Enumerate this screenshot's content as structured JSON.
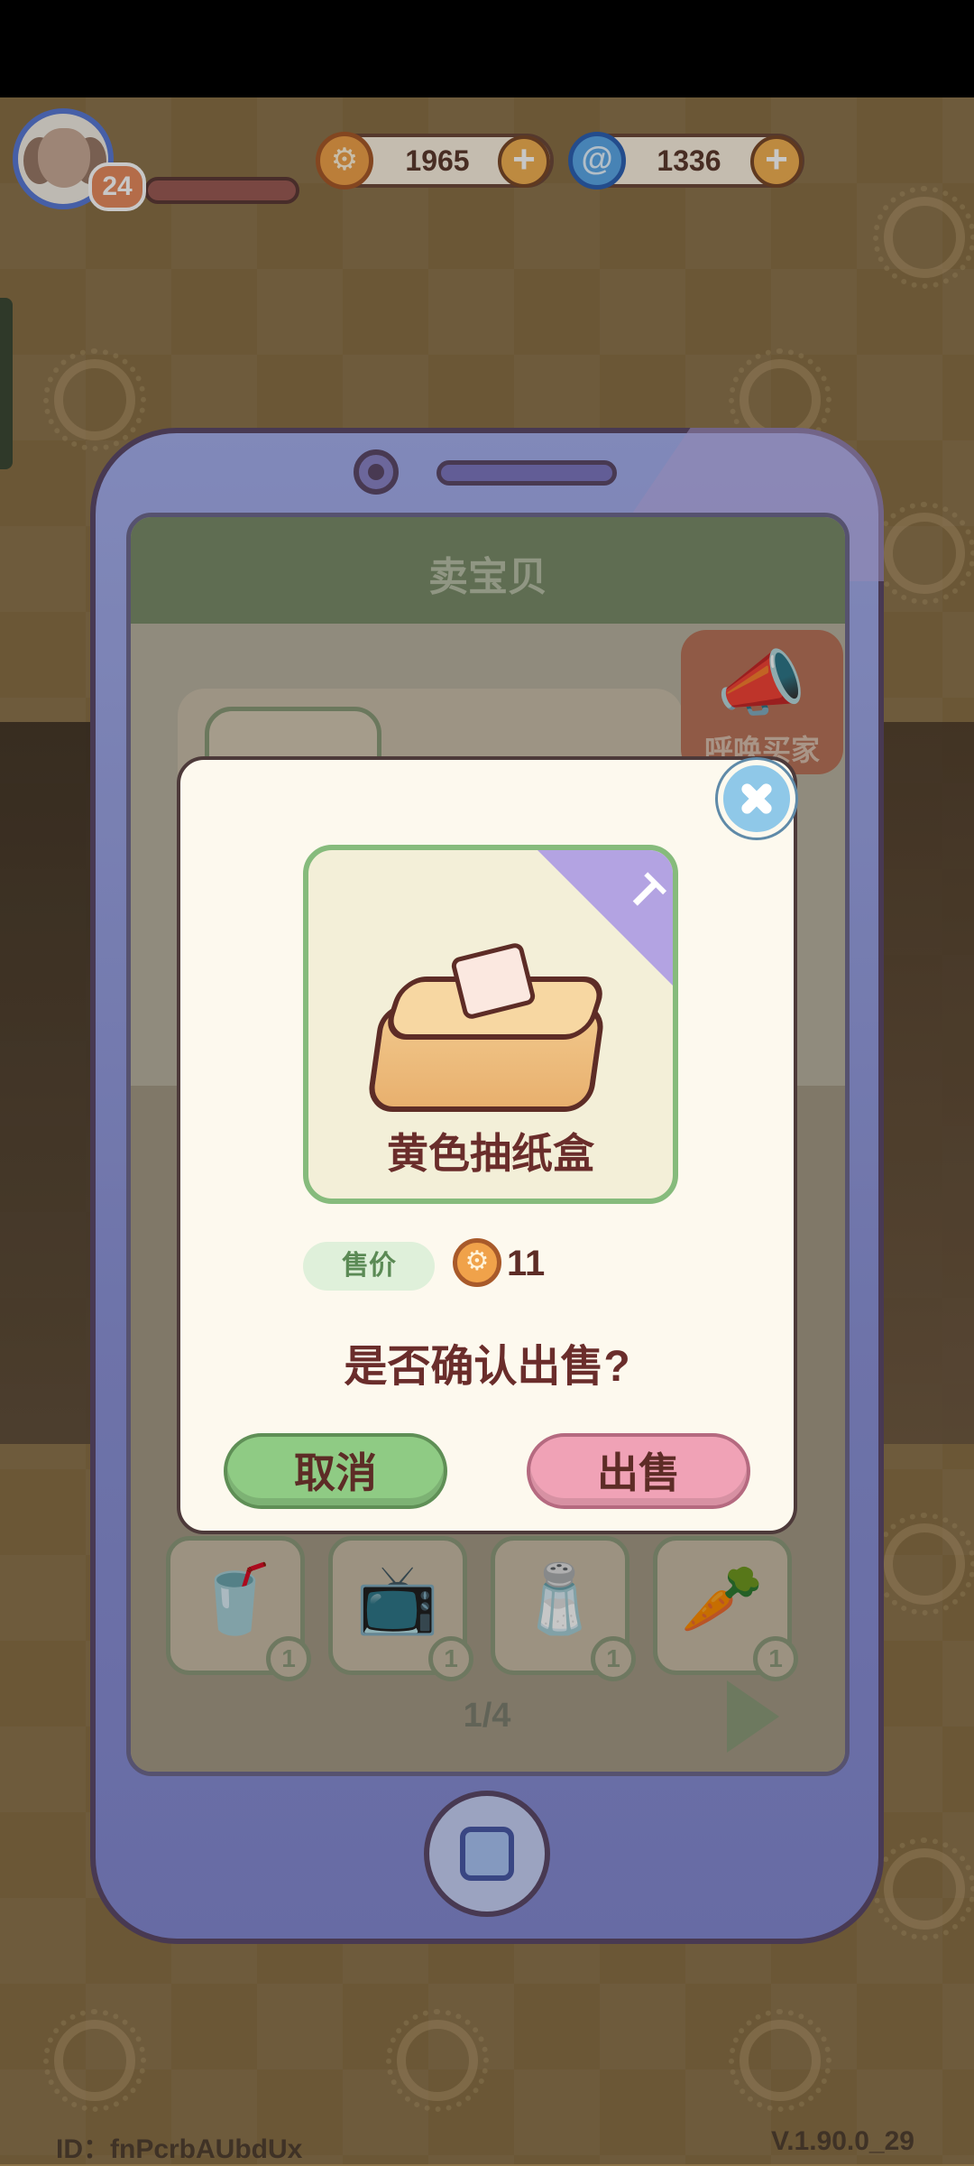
{
  "hud": {
    "level": "24",
    "coins": "1965",
    "gems": "1336"
  },
  "shop": {
    "title": "卖宝贝",
    "call_buyer_label": "呼唤买家",
    "pagination": "1/4",
    "visible_items": [
      {
        "icon": "iced-drink-icon",
        "qty": "1"
      },
      {
        "icon": "microwave-icon",
        "qty": "1"
      },
      {
        "icon": "condiment-tray-icon",
        "qty": "1"
      },
      {
        "icon": "vegetable-basket-icon",
        "qty": "1"
      }
    ]
  },
  "dialog": {
    "item_name": "黄色抽纸盒",
    "price_label": "售价",
    "price_value": "11",
    "confirm_text": "是否确认出售?",
    "cancel_label": "取消",
    "sell_label": "出售"
  },
  "footer": {
    "id_text": "ID：fnPcrbAUbdUx",
    "version": "V.1.90.0_29"
  }
}
